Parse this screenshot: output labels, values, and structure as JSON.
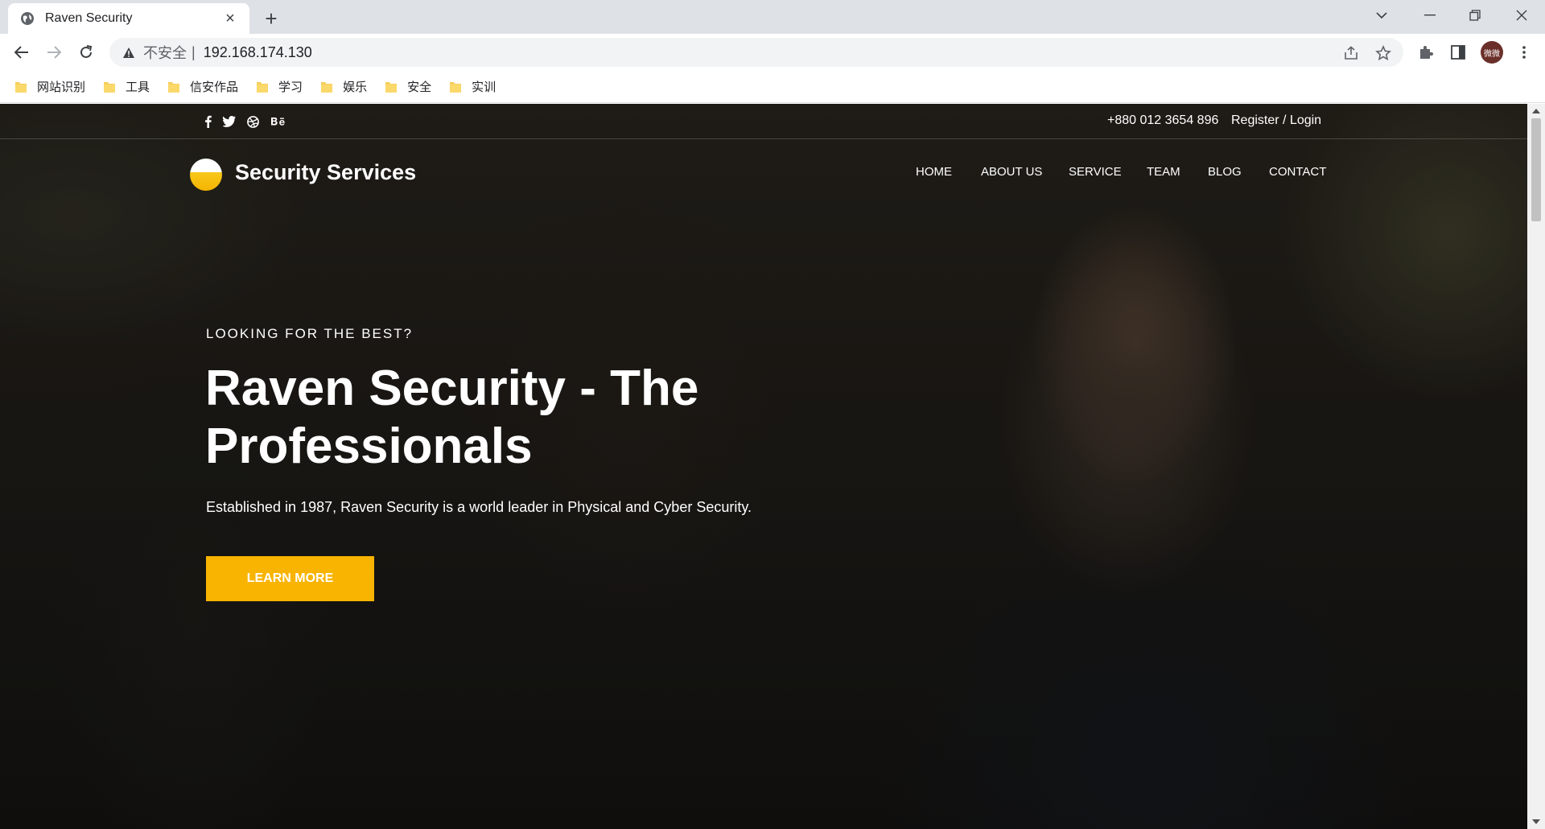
{
  "browser": {
    "tab_title": "Raven Security",
    "tab_close": "×",
    "new_tab": "+",
    "insecure_label": "不安全",
    "separator": "|",
    "url": "192.168.174.130",
    "profile_initials": "微微"
  },
  "bookmarks": [
    {
      "label": "网站识别"
    },
    {
      "label": "工具"
    },
    {
      "label": "信安作品"
    },
    {
      "label": "学习"
    },
    {
      "label": "娱乐"
    },
    {
      "label": "安全"
    },
    {
      "label": "实训"
    }
  ],
  "site": {
    "topbar": {
      "social": [
        {
          "name": "facebook-icon",
          "glyph": "f"
        },
        {
          "name": "twitter-icon",
          "glyph": "🐦"
        },
        {
          "name": "dribbble-icon",
          "glyph": "⊛"
        },
        {
          "name": "behance-icon",
          "glyph": "Bē"
        }
      ],
      "phone": "+880 012 3654 896",
      "auth": "Register / Login"
    },
    "brand": "Security Services",
    "nav": [
      "HOME",
      "ABOUT US",
      "SERVICE",
      "TEAM",
      "BLOG",
      "CONTACT"
    ],
    "hero": {
      "kicker": "LOOKING FOR THE BEST?",
      "headline": "Raven Security - The Professionals",
      "subline": "Established in 1987, Raven Security is a world leader in Physical and Cyber Security.",
      "cta": "LEARN MORE"
    },
    "accent_color": "#f8b400"
  }
}
